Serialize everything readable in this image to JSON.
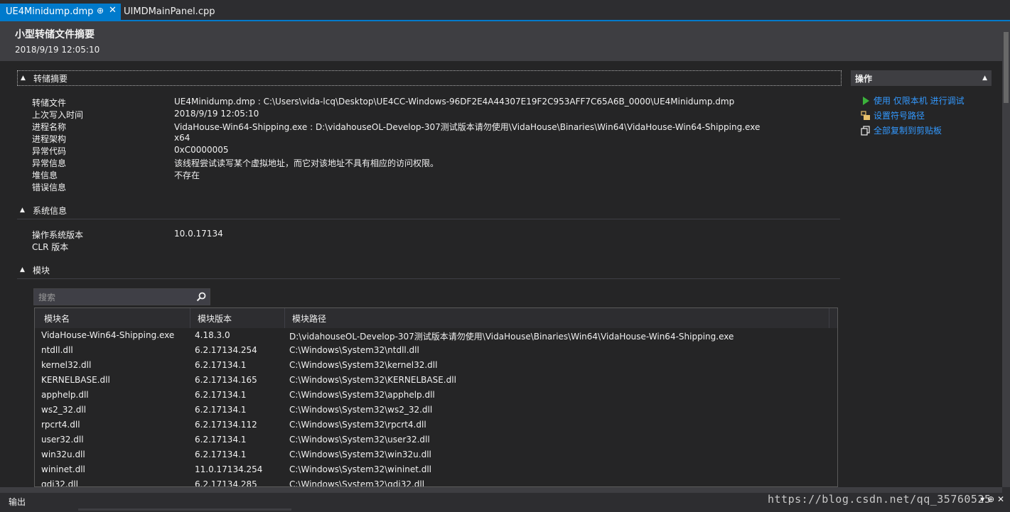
{
  "tabs": {
    "active_label": "UE4Minidump.dmp",
    "inactive_label": "UIMDMainPanel.cpp"
  },
  "header": {
    "title": "小型转储文件摘要",
    "timestamp": "2018/9/19 12:05:10"
  },
  "dump_summary": {
    "title": "转储摘要",
    "rows": [
      {
        "key": "转储文件",
        "value": "UE4Minidump.dmp : C:\\Users\\vida-lcq\\Desktop\\UE4CC-Windows-96DF2E4A44307E19F2C953AFF7C65A6B_0000\\UE4Minidump.dmp"
      },
      {
        "key": "上次写入时间",
        "value": "2018/9/19 12:05:10"
      },
      {
        "key": "进程名称",
        "value": "VidaHouse-Win64-Shipping.exe : D:\\vidahouseOL-Develop-307测试版本请勿使用\\VidaHouse\\Binaries\\Win64\\VidaHouse-Win64-Shipping.exe"
      },
      {
        "key": "进程架构",
        "value": "x64"
      },
      {
        "key": "异常代码",
        "value": "0xC0000005"
      },
      {
        "key": "异常信息",
        "value": "该线程尝试读写某个虚拟地址，而它对该地址不具有相应的访问权限。"
      },
      {
        "key": "堆信息",
        "value": "不存在"
      },
      {
        "key": "错误信息",
        "value": ""
      }
    ]
  },
  "system_info": {
    "title": "系统信息",
    "rows": [
      {
        "key": "操作系统版本",
        "value": "10.0.17134"
      },
      {
        "key": "CLR 版本",
        "value": ""
      }
    ]
  },
  "modules": {
    "title": "模块",
    "search_placeholder": "搜索",
    "columns": [
      "模块名",
      "模块版本",
      "模块路径"
    ],
    "rows": [
      [
        "VidaHouse-Win64-Shipping.exe",
        "4.18.3.0",
        "D:\\vidahouseOL-Develop-307测试版本请勿使用\\VidaHouse\\Binaries\\Win64\\VidaHouse-Win64-Shipping.exe"
      ],
      [
        "ntdll.dll",
        "6.2.17134.254",
        "C:\\Windows\\System32\\ntdll.dll"
      ],
      [
        "kernel32.dll",
        "6.2.17134.1",
        "C:\\Windows\\System32\\kernel32.dll"
      ],
      [
        "KERNELBASE.dll",
        "6.2.17134.165",
        "C:\\Windows\\System32\\KERNELBASE.dll"
      ],
      [
        "apphelp.dll",
        "6.2.17134.1",
        "C:\\Windows\\System32\\apphelp.dll"
      ],
      [
        "ws2_32.dll",
        "6.2.17134.1",
        "C:\\Windows\\System32\\ws2_32.dll"
      ],
      [
        "rpcrt4.dll",
        "6.2.17134.112",
        "C:\\Windows\\System32\\rpcrt4.dll"
      ],
      [
        "user32.dll",
        "6.2.17134.1",
        "C:\\Windows\\System32\\user32.dll"
      ],
      [
        "win32u.dll",
        "6.2.17134.1",
        "C:\\Windows\\System32\\win32u.dll"
      ],
      [
        "wininet.dll",
        "11.0.17134.254",
        "C:\\Windows\\System32\\wininet.dll"
      ],
      [
        "gdi32.dll",
        "6.2.17134.285",
        "C:\\Windows\\System32\\gdi32.dll"
      ]
    ]
  },
  "actions_panel": {
    "title": "操作",
    "items": [
      {
        "label": "使用 仅限本机 进行调试",
        "icon": "play-icon"
      },
      {
        "label": "设置符号路径",
        "icon": "symbol-path-icon"
      },
      {
        "label": "全部复制到剪贴板",
        "icon": "copy-icon"
      }
    ]
  },
  "bottom": {
    "panel_label": "输出",
    "watermark": "https://blog.csdn.net/qq_35760525"
  },
  "colors": {
    "accent": "#007acc",
    "link": "#3399ff",
    "background": "#252526"
  }
}
